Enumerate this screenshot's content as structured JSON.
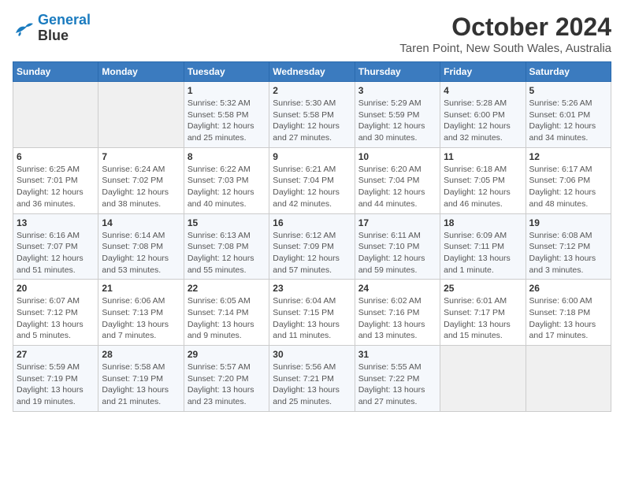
{
  "logo": {
    "line1": "General",
    "line2": "Blue"
  },
  "title": "October 2024",
  "subtitle": "Taren Point, New South Wales, Australia",
  "days_of_week": [
    "Sunday",
    "Monday",
    "Tuesday",
    "Wednesday",
    "Thursday",
    "Friday",
    "Saturday"
  ],
  "weeks": [
    [
      {
        "day": "",
        "info": ""
      },
      {
        "day": "",
        "info": ""
      },
      {
        "day": "1",
        "info": "Sunrise: 5:32 AM\nSunset: 5:58 PM\nDaylight: 12 hours\nand 25 minutes."
      },
      {
        "day": "2",
        "info": "Sunrise: 5:30 AM\nSunset: 5:58 PM\nDaylight: 12 hours\nand 27 minutes."
      },
      {
        "day": "3",
        "info": "Sunrise: 5:29 AM\nSunset: 5:59 PM\nDaylight: 12 hours\nand 30 minutes."
      },
      {
        "day": "4",
        "info": "Sunrise: 5:28 AM\nSunset: 6:00 PM\nDaylight: 12 hours\nand 32 minutes."
      },
      {
        "day": "5",
        "info": "Sunrise: 5:26 AM\nSunset: 6:01 PM\nDaylight: 12 hours\nand 34 minutes."
      }
    ],
    [
      {
        "day": "6",
        "info": "Sunrise: 6:25 AM\nSunset: 7:01 PM\nDaylight: 12 hours\nand 36 minutes."
      },
      {
        "day": "7",
        "info": "Sunrise: 6:24 AM\nSunset: 7:02 PM\nDaylight: 12 hours\nand 38 minutes."
      },
      {
        "day": "8",
        "info": "Sunrise: 6:22 AM\nSunset: 7:03 PM\nDaylight: 12 hours\nand 40 minutes."
      },
      {
        "day": "9",
        "info": "Sunrise: 6:21 AM\nSunset: 7:04 PM\nDaylight: 12 hours\nand 42 minutes."
      },
      {
        "day": "10",
        "info": "Sunrise: 6:20 AM\nSunset: 7:04 PM\nDaylight: 12 hours\nand 44 minutes."
      },
      {
        "day": "11",
        "info": "Sunrise: 6:18 AM\nSunset: 7:05 PM\nDaylight: 12 hours\nand 46 minutes."
      },
      {
        "day": "12",
        "info": "Sunrise: 6:17 AM\nSunset: 7:06 PM\nDaylight: 12 hours\nand 48 minutes."
      }
    ],
    [
      {
        "day": "13",
        "info": "Sunrise: 6:16 AM\nSunset: 7:07 PM\nDaylight: 12 hours\nand 51 minutes."
      },
      {
        "day": "14",
        "info": "Sunrise: 6:14 AM\nSunset: 7:08 PM\nDaylight: 12 hours\nand 53 minutes."
      },
      {
        "day": "15",
        "info": "Sunrise: 6:13 AM\nSunset: 7:08 PM\nDaylight: 12 hours\nand 55 minutes."
      },
      {
        "day": "16",
        "info": "Sunrise: 6:12 AM\nSunset: 7:09 PM\nDaylight: 12 hours\nand 57 minutes."
      },
      {
        "day": "17",
        "info": "Sunrise: 6:11 AM\nSunset: 7:10 PM\nDaylight: 12 hours\nand 59 minutes."
      },
      {
        "day": "18",
        "info": "Sunrise: 6:09 AM\nSunset: 7:11 PM\nDaylight: 13 hours\nand 1 minute."
      },
      {
        "day": "19",
        "info": "Sunrise: 6:08 AM\nSunset: 7:12 PM\nDaylight: 13 hours\nand 3 minutes."
      }
    ],
    [
      {
        "day": "20",
        "info": "Sunrise: 6:07 AM\nSunset: 7:12 PM\nDaylight: 13 hours\nand 5 minutes."
      },
      {
        "day": "21",
        "info": "Sunrise: 6:06 AM\nSunset: 7:13 PM\nDaylight: 13 hours\nand 7 minutes."
      },
      {
        "day": "22",
        "info": "Sunrise: 6:05 AM\nSunset: 7:14 PM\nDaylight: 13 hours\nand 9 minutes."
      },
      {
        "day": "23",
        "info": "Sunrise: 6:04 AM\nSunset: 7:15 PM\nDaylight: 13 hours\nand 11 minutes."
      },
      {
        "day": "24",
        "info": "Sunrise: 6:02 AM\nSunset: 7:16 PM\nDaylight: 13 hours\nand 13 minutes."
      },
      {
        "day": "25",
        "info": "Sunrise: 6:01 AM\nSunset: 7:17 PM\nDaylight: 13 hours\nand 15 minutes."
      },
      {
        "day": "26",
        "info": "Sunrise: 6:00 AM\nSunset: 7:18 PM\nDaylight: 13 hours\nand 17 minutes."
      }
    ],
    [
      {
        "day": "27",
        "info": "Sunrise: 5:59 AM\nSunset: 7:19 PM\nDaylight: 13 hours\nand 19 minutes."
      },
      {
        "day": "28",
        "info": "Sunrise: 5:58 AM\nSunset: 7:19 PM\nDaylight: 13 hours\nand 21 minutes."
      },
      {
        "day": "29",
        "info": "Sunrise: 5:57 AM\nSunset: 7:20 PM\nDaylight: 13 hours\nand 23 minutes."
      },
      {
        "day": "30",
        "info": "Sunrise: 5:56 AM\nSunset: 7:21 PM\nDaylight: 13 hours\nand 25 minutes."
      },
      {
        "day": "31",
        "info": "Sunrise: 5:55 AM\nSunset: 7:22 PM\nDaylight: 13 hours\nand 27 minutes."
      },
      {
        "day": "",
        "info": ""
      },
      {
        "day": "",
        "info": ""
      }
    ]
  ]
}
